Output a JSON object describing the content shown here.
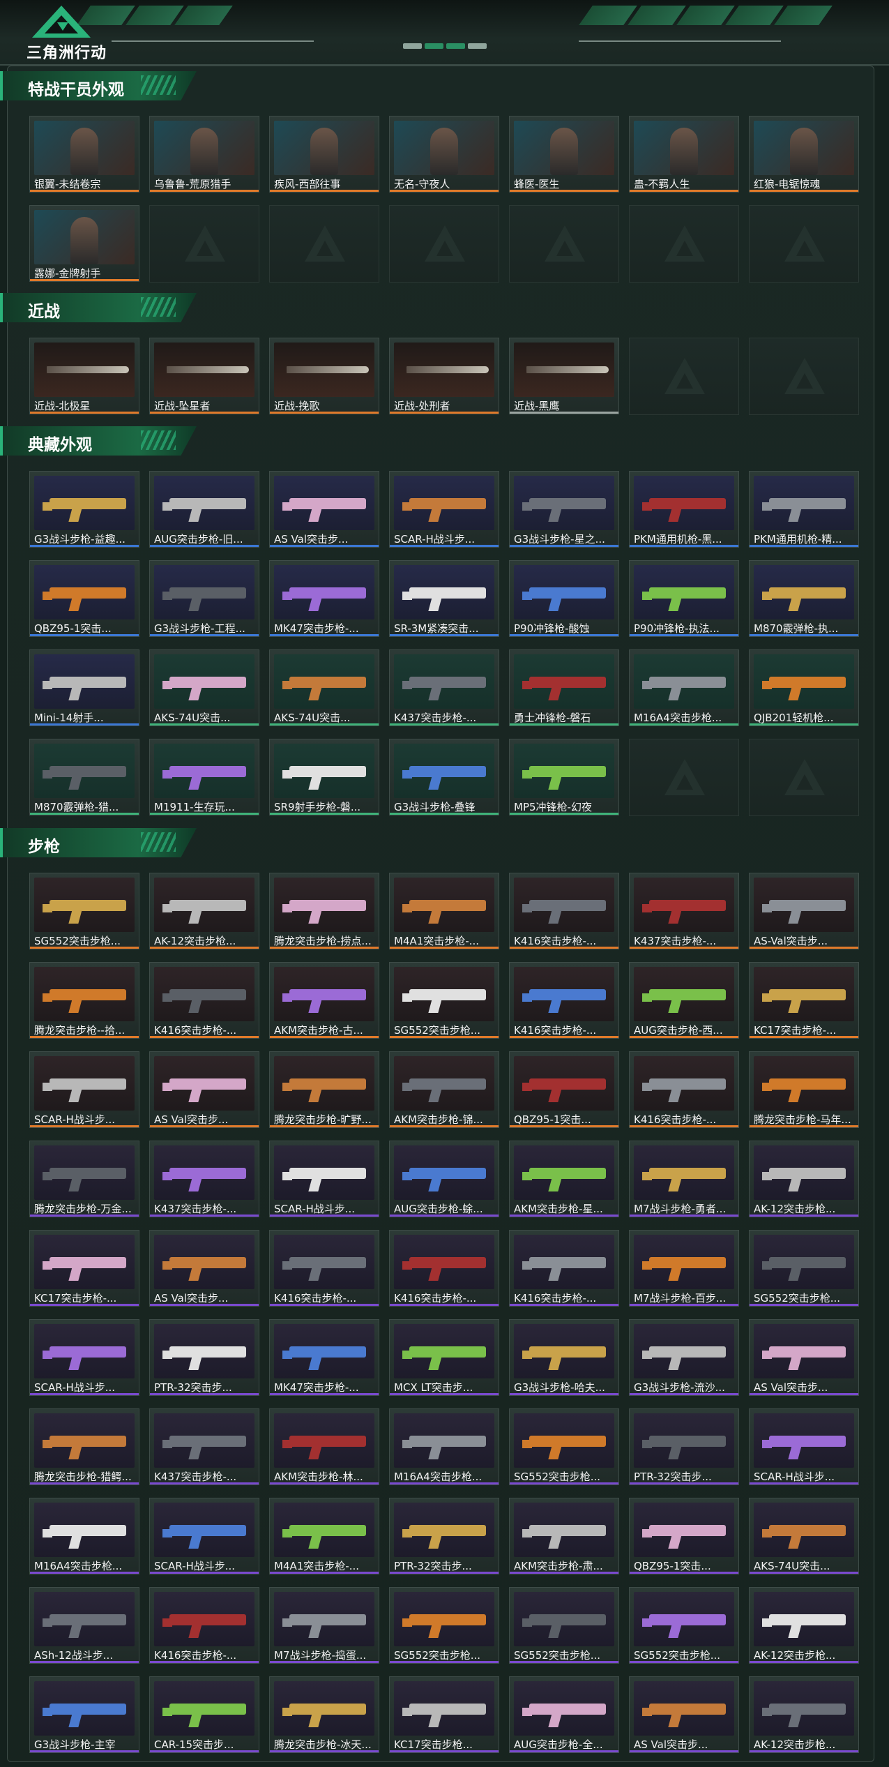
{
  "header": {
    "logo_text": "三角洲行动",
    "logo_icon": "delta-triangle-icon"
  },
  "colors": {
    "accent": "#2ab37a",
    "orange": "#e07a2a",
    "blue": "#3b78d6",
    "purple": "#7a4ad0"
  },
  "sections": {
    "operators": {
      "title": "特战干员外观",
      "items": [
        "银翼-未结卷宗",
        "乌鲁鲁-荒原猎手",
        "疾风-西部往事",
        "无名-守夜人",
        "蜂医-医生",
        "蛊-不羁人生",
        "红狼-电锯惊魂",
        "露娜-金牌射手"
      ]
    },
    "melee": {
      "title": "近战",
      "items": [
        "近战-北极星",
        "近战-坠星者",
        "近战-挽歌",
        "近战-处刑者",
        "近战-黑鹰"
      ]
    },
    "collection": {
      "title": "典藏外观",
      "items": [
        "G3战斗步枪-益趣...",
        "AUG突击步枪-旧...",
        "AS Val突击步...",
        "SCAR-H战斗步...",
        "G3战斗步枪-星之...",
        "PKM通用机枪-黑...",
        "PKM通用机枪-精...",
        "QBZ95-1突击...",
        "G3战斗步枪-工程...",
        "MK47突击步枪-...",
        "SR-3M紧凑突击...",
        "P90冲锋枪-酸蚀",
        "P90冲锋枪-执法...",
        "M870霰弹枪-执...",
        "Mini-14射手...",
        "AKS-74U突击...",
        "AKS-74U突击...",
        "K437突击步枪-...",
        "勇士冲锋枪-磐石",
        "M16A4突击步枪...",
        "QJB201轻机枪...",
        "M870霰弹枪-猎...",
        "M1911-生存玩...",
        "SR9射手步枪-磐...",
        "G3战斗步枪-叠锋",
        "MP5冲锋枪-幻夜"
      ]
    },
    "rifles": {
      "title": "步枪",
      "items": [
        "SG552突击步枪...",
        "AK-12突击步枪...",
        "腾龙突击步枪-捞点...",
        "M4A1突击步枪-...",
        "K416突击步枪-...",
        "K437突击步枪-...",
        "AS-Val突击步...",
        "腾龙突击步枪--拾...",
        "K416突击步枪-...",
        "AKM突击步枪-古...",
        "SG552突击步枪...",
        "K416突击步枪-...",
        "AUG突击步枪-西...",
        "KC17突击步枪-...",
        "SCAR-H战斗步...",
        "AS Val突击步...",
        "腾龙突击步枪-旷野...",
        "AKM突击步枪-锦...",
        "QBZ95-1突击...",
        "K416突击步枪-...",
        "腾龙突击步枪-马年...",
        "腾龙突击步枪-万金...",
        "K437突击步枪-...",
        "SCAR-H战斗步...",
        "AUG突击步枪-蜍...",
        "AKM突击步枪-星...",
        "M7战斗步枪-勇者...",
        "AK-12突击步枪...",
        "KC17突击步枪-...",
        "AS Val突击步...",
        "K416突击步枪-...",
        "K416突击步枪-...",
        "K416突击步枪-...",
        "M7战斗步枪-百步...",
        "SG552突击步枪...",
        "SCAR-H战斗步...",
        "PTR-32突击步...",
        "MK47突击步枪-...",
        "MCX LT突击步...",
        "G3战斗步枪-哈夫...",
        "G3战斗步枪-流沙...",
        "AS Val突击步...",
        "腾龙突击步枪-猎鳄...",
        "K437突击步枪-...",
        "AKM突击步枪-林...",
        "M16A4突击步枪...",
        "SG552突击步枪...",
        "PTR-32突击步...",
        "SCAR-H战斗步...",
        "M16A4突击步枪...",
        "SCAR-H战斗步...",
        "M4A1突击步枪-...",
        "PTR-32突击步...",
        "AKM突击步枪-肃...",
        "QBZ95-1突击...",
        "AKS-74U突击...",
        "ASh-12战斗步...",
        "K416突击步枪-...",
        "M7战斗步枪-捣蛋...",
        "SG552突击步枪...",
        "SG552突击步枪...",
        "SG552突击步枪...",
        "AK-12突击步枪...",
        "G3战斗步枪-主宰",
        "CAR-15突击步...",
        "腾龙突击步枪-冰天...",
        "KC17突击步枪...",
        "AUG突击步枪-全...",
        "AS Val突击步...",
        "AK-12突击步枪..."
      ]
    }
  }
}
